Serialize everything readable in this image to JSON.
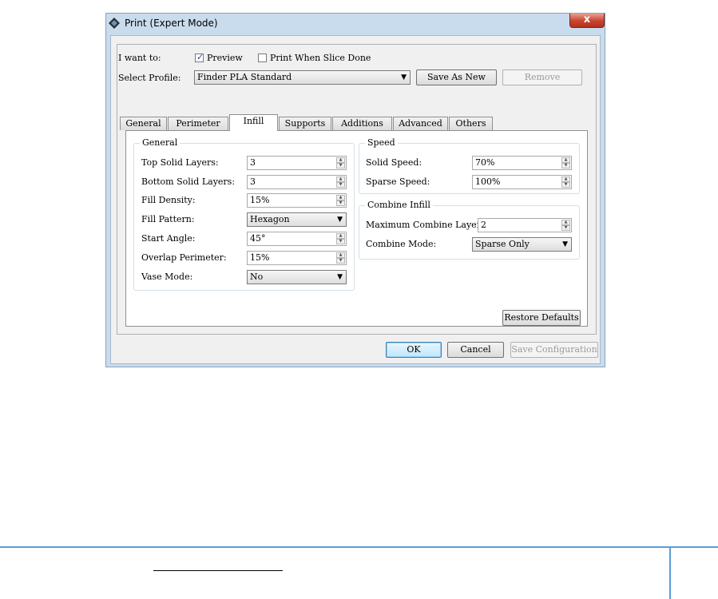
{
  "window": {
    "title": "Print (Expert Mode)",
    "close_label": "x"
  },
  "icons": {
    "app": "diamond-icon",
    "close": "close-icon",
    "dropdown": "chevron-down-icon",
    "checkmark": "check-icon"
  },
  "top": {
    "i_want_to": "I want to:",
    "preview_label": "Preview",
    "preview_checked": true,
    "print_when_done_label": "Print When Slice Done",
    "print_when_done_checked": false,
    "select_profile_label": "Select Profile:",
    "profile_value": "Finder PLA Standard",
    "save_as_new": "Save As New",
    "remove": "Remove"
  },
  "tabs": [
    "General",
    "Perimeter",
    "Infill",
    "Supports",
    "Additions",
    "Advanced",
    "Others"
  ],
  "active_tab": "Infill",
  "general": {
    "legend": "General",
    "top_solid_layers_label": "Top Solid Layers:",
    "top_solid_layers": "3",
    "bottom_solid_layers_label": "Bottom Solid Layers:",
    "bottom_solid_layers": "3",
    "fill_density_label": "Fill Density:",
    "fill_density": "15%",
    "fill_pattern_label": "Fill Pattern:",
    "fill_pattern": "Hexagon",
    "start_angle_label": "Start Angle:",
    "start_angle": "45°",
    "overlap_perimeter_label": "Overlap Perimeter:",
    "overlap_perimeter": "15%",
    "vase_mode_label": "Vase Mode:",
    "vase_mode": "No"
  },
  "speed": {
    "legend": "Speed",
    "solid_speed_label": "Solid Speed:",
    "solid_speed": "70%",
    "sparse_speed_label": "Sparse Speed:",
    "sparse_speed": "100%"
  },
  "combine": {
    "legend": "Combine Infill",
    "max_layers_label": "Maximum Combine Layers:",
    "max_layers": "2",
    "mode_label": "Combine Mode:",
    "mode": "Sparse Only"
  },
  "buttons": {
    "restore_defaults": "Restore Defaults",
    "ok": "OK",
    "cancel": "Cancel",
    "save_configuration": "Save Configuration"
  },
  "colors": {
    "title_bar": "#c9dced",
    "close": "#c7432e",
    "footer_rule": "#5b9bd5"
  }
}
